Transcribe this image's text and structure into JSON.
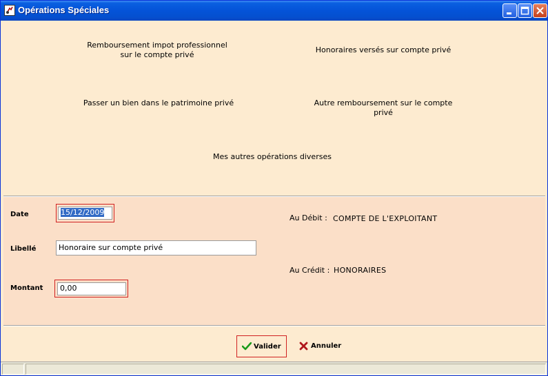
{
  "window": {
    "title": "Opérations Spéciales"
  },
  "operations": [
    "Remboursement impot professionnel\nsur le compte privé",
    "Honoraires versés sur compte privé",
    "Passer un bien dans le patrimoine privé",
    "Autre remboursement sur le compte privé",
    "Mes autres opérations diverses"
  ],
  "form": {
    "date_label": "Date",
    "date_value": "15/12/2009",
    "libelle_label": "Libellé",
    "libelle_value": "Honoraire sur compte privé",
    "montant_label": "Montant",
    "montant_value": "0,00",
    "debit_label": "Au Débit :",
    "debit_value": "COMPTE DE L'EXPLOITANT",
    "credit_label": "Au Crédit :",
    "credit_value": "HONORAIRES"
  },
  "buttons": {
    "valider": "Valider",
    "annuler": "Annuler"
  },
  "colors": {
    "panel_bg": "#fdebd0",
    "form_bg": "#fbdfc8",
    "focus_border": "#d02020",
    "title_blue": "#0453d8"
  }
}
